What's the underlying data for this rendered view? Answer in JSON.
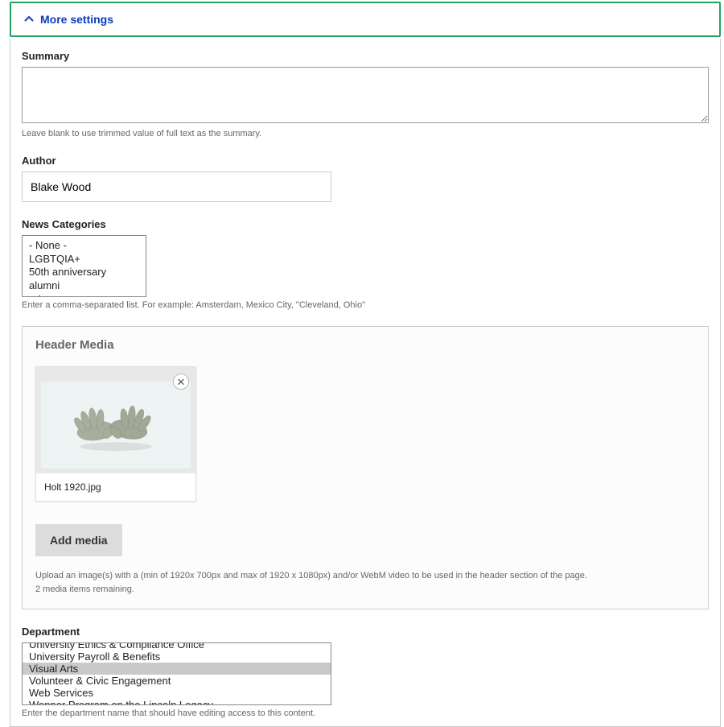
{
  "more_settings": {
    "label": "More settings"
  },
  "summary": {
    "label": "Summary",
    "value": "",
    "help": "Leave blank to use trimmed value of full text as the summary."
  },
  "author": {
    "label": "Author",
    "value": "Blake Wood"
  },
  "news_categories": {
    "label": "News Categories",
    "options": [
      "- None -",
      "LGBTQIA+",
      "50th anniversary",
      "alumni",
      "arts"
    ],
    "help": "Enter a comma-separated list. For example: Amsterdam, Mexico City, \"Cleveland, Ohio\""
  },
  "header_media": {
    "title": "Header Media",
    "file": {
      "name": "Holt 1920.jpg"
    },
    "add_button": "Add media",
    "help_line1": "Upload an image(s) with a (min of 1920x 700px and max of 1920 x 1080px) and/or WebM video to be used in the header section of the page.",
    "help_line2": "2 media items remaining."
  },
  "department": {
    "label": "Department",
    "options": [
      "University Ethics & Compliance Office",
      "University Payroll & Benefits",
      "Visual Arts",
      "Volunteer & Civic Engagement",
      "Web Services",
      "Wepner Program on the Lincoln Legacy"
    ],
    "selected": "Visual Arts",
    "help": "Enter the department name that should have editing access to this content."
  }
}
